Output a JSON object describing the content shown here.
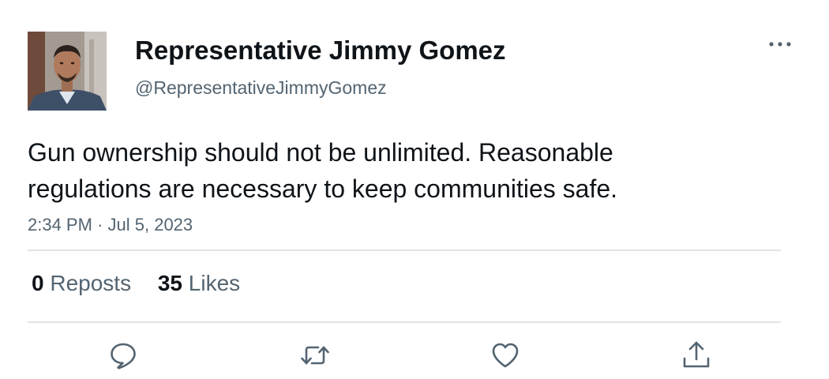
{
  "author": {
    "display_name": "Representative Jimmy Gomez",
    "handle": "@RepresentativeJimmyGomez"
  },
  "tweet": {
    "text_lines": [
      "Gun ownership should not be unlimited. Reasonable",
      "regulations are necessary to keep communities safe."
    ],
    "time": "2:34 PM",
    "separator": "·",
    "date": "Jul 5, 2023"
  },
  "stats": {
    "reposts_count": "0",
    "reposts_label": "Reposts",
    "likes_count": "35",
    "likes_label": "Likes"
  },
  "icons": {
    "more": "more-horizontal-icon",
    "reply": "reply-icon",
    "repost": "repost-icon",
    "like": "heart-icon",
    "share": "share-icon"
  },
  "colors": {
    "text_primary": "#0f1419",
    "text_secondary": "#536471",
    "divider": "#dfe3e6",
    "icon": "#536471"
  }
}
